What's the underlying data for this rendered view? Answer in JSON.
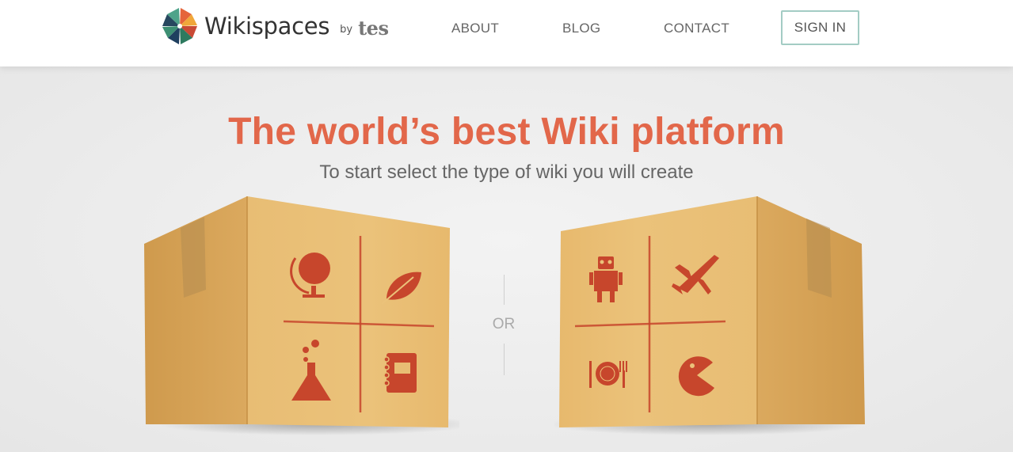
{
  "header": {
    "logo_text": "Wikispaces",
    "logo_by": "by",
    "logo_tes": "tes",
    "nav": [
      {
        "label": "ABOUT"
      },
      {
        "label": "BLOG"
      },
      {
        "label": "CONTACT"
      }
    ],
    "signin_label": "SIGN IN"
  },
  "hero": {
    "headline": "The world’s best Wiki platform",
    "subhead": "To start select the type of wiki you will create",
    "or_label": "OR",
    "left_box": {
      "icons": [
        "globe-icon",
        "leaf-icon",
        "flask-icon",
        "notebook-icon"
      ]
    },
    "right_box": {
      "icons": [
        "robot-icon",
        "airplane-icon",
        "plate-cutlery-icon",
        "pacman-icon"
      ]
    }
  },
  "colors": {
    "accent": "#e2674a",
    "signin_border": "#a3ccc4",
    "stamp": "#c7462c",
    "cardboard": "#dfae66"
  }
}
